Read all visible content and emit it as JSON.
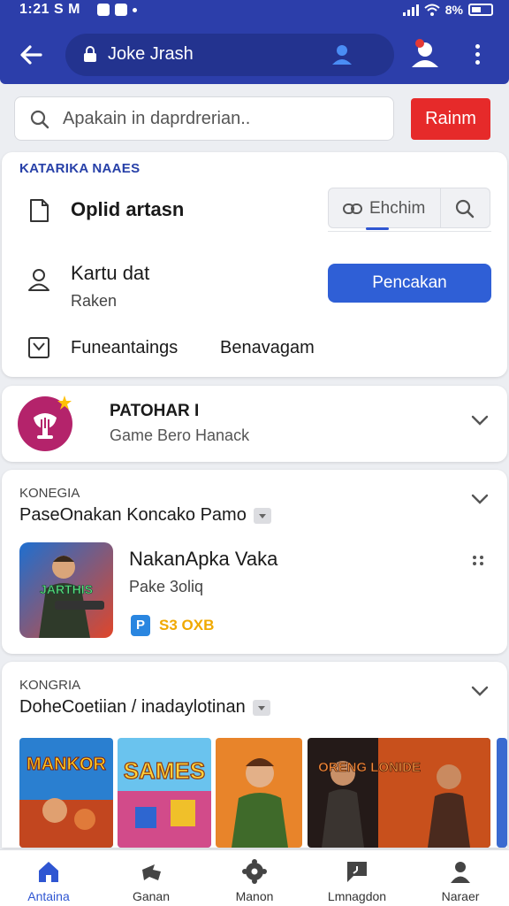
{
  "status_bar": {
    "time": "1:21 S M",
    "battery": "8%"
  },
  "app_bar": {
    "url_text": "Joke Jrash"
  },
  "search": {
    "placeholder": "Apakain in daprdrerian..",
    "button_label": "Rainm"
  },
  "section_card": {
    "title": "KATARIKA NAAES",
    "row1_label": "Oplid artasn",
    "segment_label": "Ehchim",
    "row2_title": "Kartu dat",
    "row2_subtitle": "Raken",
    "row2_button": "Pencakan",
    "row3_left": "Funeantaings",
    "row3_right": "Benavagam"
  },
  "featured_app": {
    "title": "PATOHAR I",
    "subtitle": "Game Bero Hanack"
  },
  "category_one": {
    "category": "KONEGIA",
    "heading": "PaseOnakan Koncako Pamo",
    "game_title": "NakanApka Vaka",
    "game_subtitle": "Pake 3oliq",
    "badge": "P",
    "price": "S3 OXB",
    "thumb_text": "JARTHIS"
  },
  "category_two": {
    "category": "KONGRIA",
    "heading": "DoheCoetiian / inadaylotinan",
    "thumbs": [
      "MANKOR",
      "SAMES",
      "",
      "ORENG LONIDE",
      ""
    ]
  },
  "bottom_nav": [
    {
      "label": "Antaina",
      "icon": "home-icon",
      "active": true
    },
    {
      "label": "Ganan",
      "icon": "gamepad-icon",
      "active": false
    },
    {
      "label": "Manon",
      "icon": "gear-icon",
      "active": false
    },
    {
      "label": "Lmnagdon",
      "icon": "tag-icon",
      "active": false
    },
    {
      "label": "Naraer",
      "icon": "person-icon",
      "active": false
    }
  ],
  "colors": {
    "primary": "#2c3eaa",
    "accent_blue": "#2f5fd6",
    "accent_red": "#e62a2a",
    "price_yellow": "#f0a900"
  }
}
